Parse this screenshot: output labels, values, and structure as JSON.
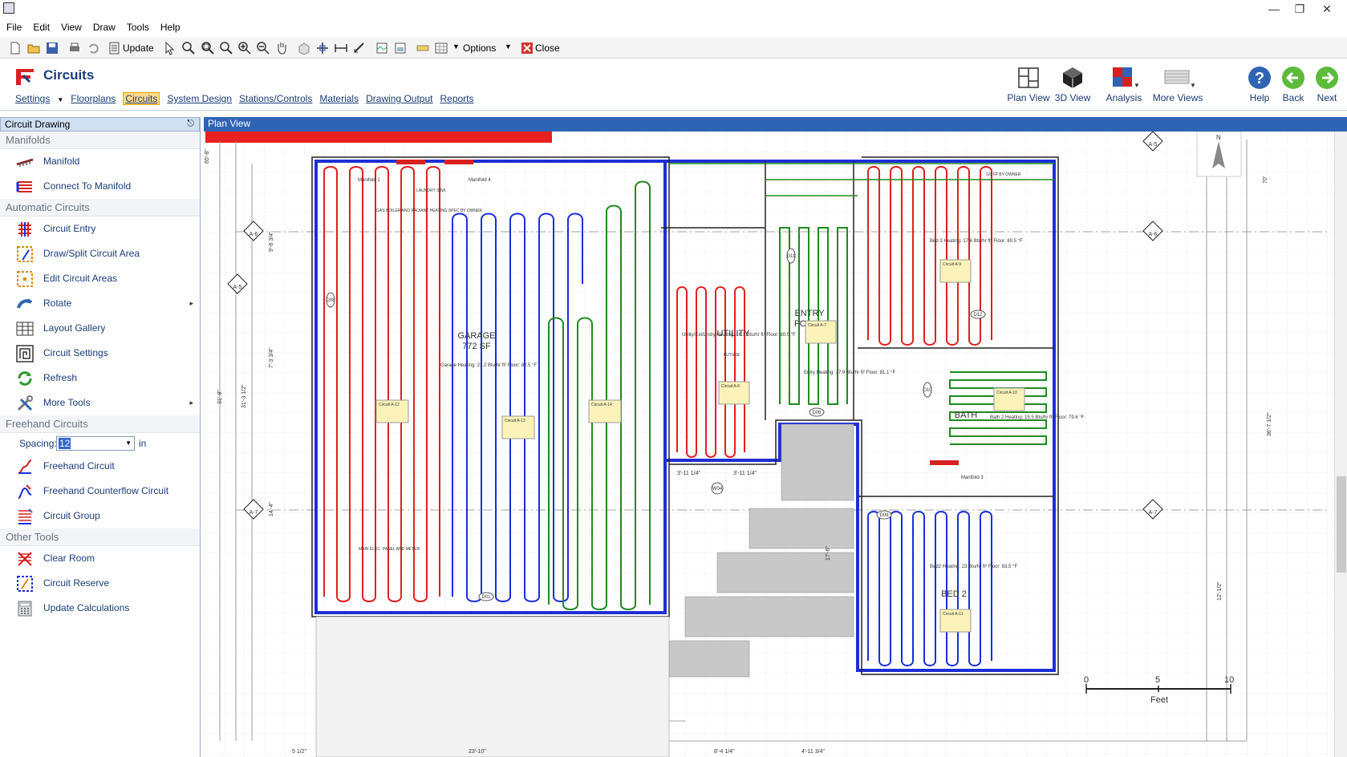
{
  "menu": [
    "File",
    "Edit",
    "View",
    "Draw",
    "Tools",
    "Help"
  ],
  "toolbar": {
    "update_label": "Update",
    "options_label": "Options",
    "close_label": "Close"
  },
  "ribbon": {
    "title": "Circuits",
    "tabs": [
      "Settings",
      "Floorplans",
      "Circuits",
      "System Design",
      "Stations/Controls",
      "Materials",
      "Drawing Output",
      "Reports"
    ],
    "active_tab": "Circuits",
    "views": {
      "plan": "Plan View",
      "three_d": "3D View",
      "analysis": "Analysis",
      "more": "More Views",
      "help": "Help",
      "back": "Back",
      "next": "Next"
    }
  },
  "left_panel": {
    "title": "Circuit Drawing",
    "groups": {
      "manifolds": "Manifolds",
      "automatic": "Automatic Circuits",
      "freehand": "Freehand Circuits",
      "other": "Other Tools"
    },
    "manifold_tools": [
      "Manifold",
      "Connect To Manifold"
    ],
    "automatic_tools": [
      "Circuit Entry",
      "Draw/Split Circuit Area",
      "Edit Circuit Areas",
      "Rotate",
      "Layout Gallery",
      "Circuit Settings",
      "Refresh",
      "More Tools"
    ],
    "spacing": {
      "label": "Spacing:",
      "value": "12",
      "unit": "in"
    },
    "freehand_tools": [
      "Freehand Circuit",
      "Freehand Counterflow Circuit",
      "Circuit Group"
    ],
    "other_tools": [
      "Clear Room",
      "Circuit Reserve",
      "Update Calculations"
    ]
  },
  "plan_view": {
    "title": "Plan View",
    "rooms": {
      "garage": "GARAGE",
      "garage_area": "772 SF",
      "entry": "ENTRY",
      "foyer": "FOYER",
      "bath": "BATH",
      "bed2": "BED 2",
      "utility": "UTILITY"
    },
    "room_loads": {
      "garage": "Garage\nHeating: 21.2 Btu/hr ft²\nFloor: 82.5 °F",
      "entry": "Entry\nHeating: 17.9 Btu/hr ft²\nFloor: 81.1 °F",
      "bed2": "Bed2\nHeating: 23 Btu/hr ft²\nFloor: 83.5 °F",
      "bed3": "Bed 3\nHeating: 17.6 Btu/hr ft²\nFloor: 80.5 °F",
      "bath": "Bath 2\nHeating: 15.5 Btu/hr ft²\nFloor: 79.6 °F",
      "utility": "Utility/Ext/Lndry\nHeating: 16.1 Btu/hr ft²\nFloor: 80.0 °F"
    },
    "circuit_tags": [
      "Circuit A-12",
      "Circuit A-13",
      "Circuit A-14",
      "Circuit A-6",
      "Circuit A-7",
      "Circuit A-9",
      "Circuit A-10",
      "Circuit A-11"
    ],
    "manifold_labels": [
      "Manifold 1",
      "Manifold 4",
      "Manifold 3"
    ],
    "door_tags": [
      "D01",
      "D06",
      "D08",
      "D09",
      "D10",
      "D11",
      "D12",
      "W04"
    ],
    "dimensions": [
      "23'-10\"",
      "8'-4 1/4\"",
      "4'-11 3/4\"",
      "5 1/2\"",
      "3'-11 1/4\"",
      "3'-11 1/4\"",
      "31'-8\"",
      "31'-3 1/2\"",
      "7'-3 3/4\"",
      "9'-6 3/4\"",
      "14'-4\"",
      "17'-6\"",
      "12'-1/2\"",
      "36'-7 1/2\"",
      "70'",
      "65'-8\""
    ],
    "grid_tags": [
      "A-5",
      "A-6",
      "A-7"
    ],
    "scale": {
      "labels": [
        "0",
        "5",
        "10"
      ],
      "unit": "Feet"
    },
    "notes": [
      "LAUNDRY SINK",
      "GAS BOILER AND RADIANT HEATING SPEC BY OWNER",
      "MAIN ELEC. PANEL AND METER",
      "FUTURE",
      "GS FP BY OWNER"
    ]
  },
  "colors": {
    "accent": "#2f64b4",
    "circuit_red": "#e02020",
    "circuit_blue": "#1a2ee0",
    "circuit_green": "#1f8a1f",
    "wall_blue": "#1d2fd6"
  }
}
